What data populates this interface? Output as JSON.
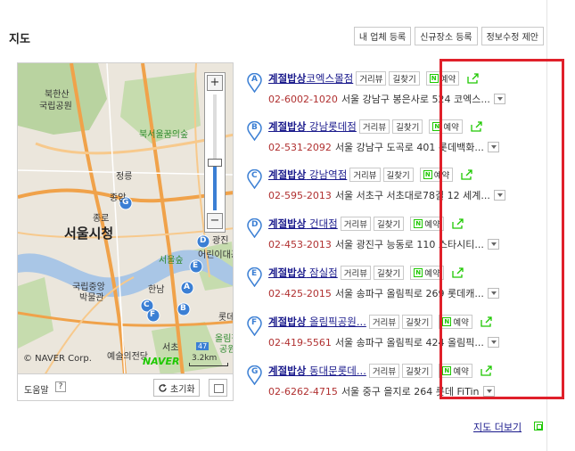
{
  "section_title": "지도",
  "top_buttons": [
    "내 업체 등록",
    "신규장소 등록",
    "정보수정 제안"
  ],
  "map": {
    "labels": [
      "북한산",
      "국립공원",
      "북서울꿈의숲",
      "정릉",
      "종암",
      "종로",
      "서울시청",
      "어린이대공",
      "국립중앙",
      "박물관",
      "한남",
      "서울숲",
      "광진",
      "롯데",
      "서초",
      "예술의전당",
      "올림픽",
      "공원",
      "47"
    ],
    "pin_letters": [
      "G",
      "D",
      "E",
      "A",
      "B",
      "C",
      "F"
    ],
    "copyright": "© NAVER Corp.",
    "logo": "NAVER",
    "scale": "3.2km",
    "help_label": "도움말",
    "help_q": "?",
    "reset_label": "초기화"
  },
  "actions": {
    "review": "거리뷰",
    "directions": "길찾기",
    "reserve": "예약"
  },
  "results": [
    {
      "letter": "A",
      "brand": "계절밥상",
      "branch": "코엑스몰점",
      "phone": "02-6002-1020",
      "address": "서울 강남구 봉은사로 524 코엑스..."
    },
    {
      "letter": "B",
      "brand": "계절밥상",
      "branch": " 강남롯데점",
      "phone": "02-531-2092",
      "address": "서울 강남구 도곡로 401 롯데백화..."
    },
    {
      "letter": "C",
      "brand": "계절밥상",
      "branch": " 강남역점",
      "phone": "02-595-2013",
      "address": "서울 서초구 서초대로78길 12 세계..."
    },
    {
      "letter": "D",
      "brand": "계절밥상",
      "branch": " 건대점",
      "phone": "02-453-2013",
      "address": "서울 광진구 능동로 110 스타시티..."
    },
    {
      "letter": "E",
      "brand": "계절밥상",
      "branch": " 잠실점",
      "phone": "02-425-2015",
      "address": "서울 송파구 올림픽로 269 롯데캐..."
    },
    {
      "letter": "F",
      "brand": "계절밥상",
      "branch": " 올림픽공원...",
      "phone": "02-419-5561",
      "address": "서울 송파구 올림픽로 424 올림픽..."
    },
    {
      "letter": "G",
      "brand": "계절밥상",
      "branch": " 동대문롯데...",
      "phone": "02-6262-4715",
      "address": "서울 중구 을지로 264 롯데 FiTin"
    }
  ],
  "more_link": "지도 더보기",
  "colors": {
    "highlight": "#e0202a",
    "pin": "#3b7fd4",
    "naver_green": "#1ec800",
    "phone": "#b03030",
    "link": "#1a1a8c"
  },
  "icons": [
    "map-pin-icon",
    "naver-n-icon",
    "share-icon",
    "dropdown-icon",
    "refresh-icon",
    "expand-icon"
  ]
}
